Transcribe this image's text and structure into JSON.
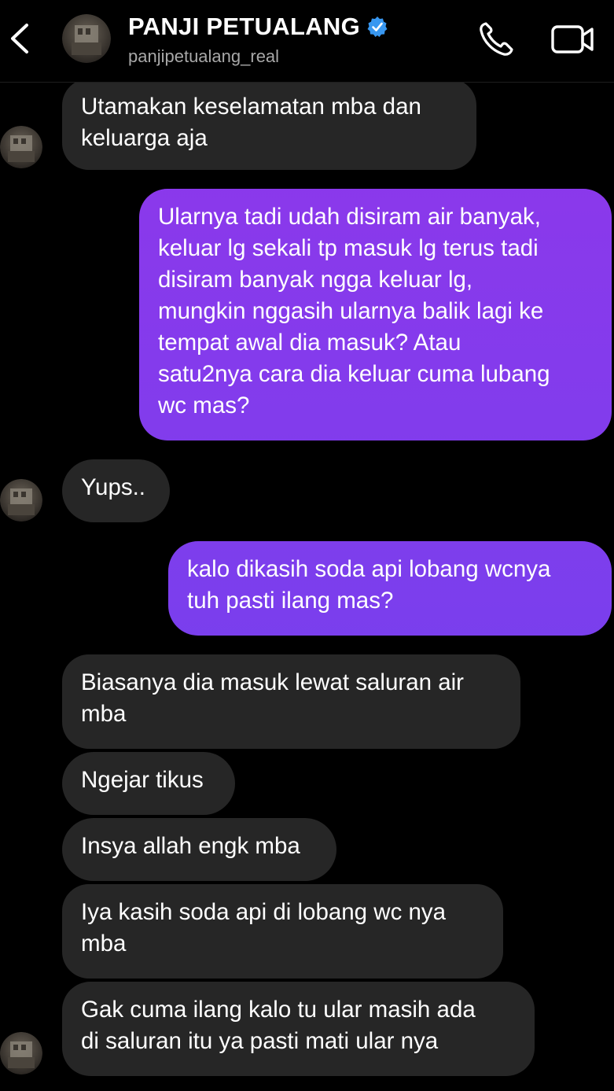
{
  "header": {
    "name": "PANJI PETUALANG",
    "handle": "panjipetualang_real",
    "back_icon": "chevron-left-icon",
    "verified_icon": "verified-badge-icon",
    "call_icon": "phone-icon",
    "video_icon": "video-camera-icon"
  },
  "colors": {
    "incoming_bubble": "#262626",
    "outgoing_gradient_top": "#9136ea",
    "outgoing_gradient_bottom": "#6a45ef",
    "verified": "#3897f0",
    "background": "#000000"
  },
  "messages": [
    {
      "from": "them",
      "lines": [
        "Utamakan keselamatan mba dan",
        "keluarga aja"
      ]
    },
    {
      "from": "me",
      "lines": [
        "Ularnya tadi udah disiram air banyak,",
        "keluar lg sekali tp masuk lg terus tadi",
        "disiram banyak ngga keluar lg,",
        "mungkin nggasih ularnya balik lagi ke",
        "tempat awal dia masuk? Atau",
        "satu2nya cara dia keluar cuma lubang",
        "wc mas?"
      ]
    },
    {
      "from": "them",
      "lines": [
        "Yups.."
      ]
    },
    {
      "from": "me",
      "lines": [
        "kalo dikasih soda api lobang wcnya",
        "tuh pasti ilang mas?"
      ]
    },
    {
      "from": "them",
      "lines": [
        "Biasanya dia masuk lewat saluran air",
        "mba"
      ]
    },
    {
      "from": "them",
      "lines": [
        "Ngejar tikus"
      ]
    },
    {
      "from": "them",
      "lines": [
        "Insya allah engk mba"
      ]
    },
    {
      "from": "them",
      "lines": [
        "Iya kasih soda api di lobang wc nya",
        "mba"
      ]
    },
    {
      "from": "them",
      "lines": [
        "Gak cuma ilang kalo tu ular masih ada",
        "di saluran itu ya pasti mati ular nya"
      ]
    }
  ]
}
